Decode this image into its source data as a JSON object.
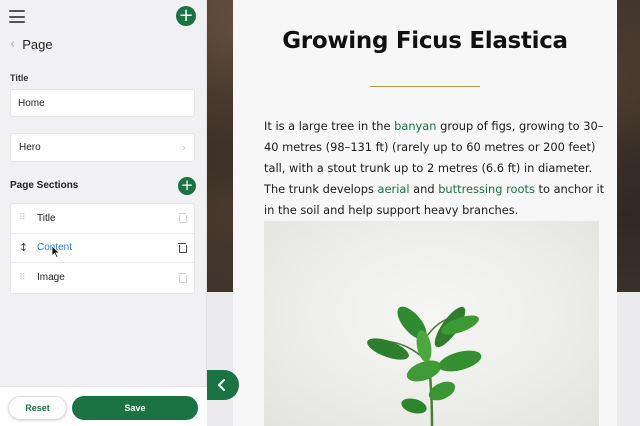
{
  "sidebar": {
    "back_label": "Page",
    "title_field": {
      "label": "Title",
      "value": "Home"
    },
    "hero": {
      "label": "Hero"
    },
    "sections": {
      "heading": "Page Sections",
      "items": [
        {
          "label": "Title",
          "active": false
        },
        {
          "label": "Content",
          "active": true
        },
        {
          "label": "Image",
          "active": false
        }
      ]
    },
    "buttons": {
      "reset": "Reset",
      "save": "Save"
    }
  },
  "article": {
    "title": "Growing Ficus Elastica",
    "p": {
      "t1": "It is a large tree in the ",
      "l1": "banyan",
      "t2": " group of figs, growing to 30–40 metres (98–131 ft) (rarely up to 60 metres or 200 feet) tall, with a stout trunk up to 2 metres (6.6 ft) in diameter. The trunk develops ",
      "l2": "aerial",
      "t3": " and ",
      "l3": "buttressing roots",
      "t4": " to anchor it in the soil and help support heavy branches."
    }
  },
  "colors": {
    "accent": "#1a7342",
    "active_section": "#2f7fc4",
    "title_rule": "#b39552"
  },
  "icons": {
    "menu": "hamburger-icon",
    "add": "plus-icon",
    "back": "chevron-left-icon",
    "hero_arrow": "chevron-right-icon",
    "drag": "drag-handle-icon",
    "delete": "trash-icon",
    "collapse": "chevron-left-icon"
  }
}
